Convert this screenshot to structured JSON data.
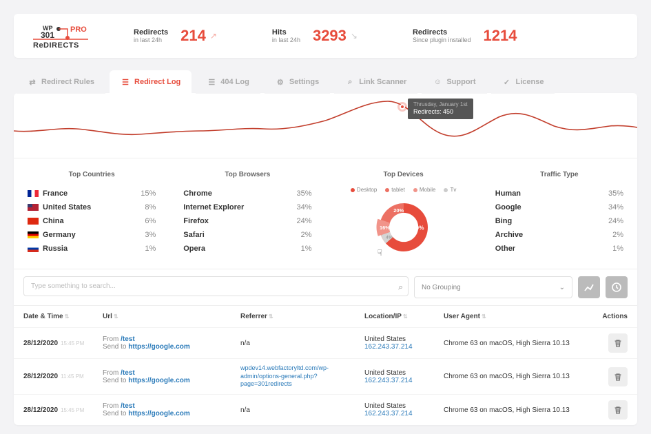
{
  "header": {
    "logo": {
      "wp": "WP",
      "num": "301",
      "pro": "PRO",
      "red": "ReDIRECTS"
    },
    "stats": [
      {
        "label": "Redirects",
        "sub": "in last 24h",
        "value": "214",
        "trend": "up"
      },
      {
        "label": "Hits",
        "sub": "in last 24h",
        "value": "3293",
        "trend": "down"
      },
      {
        "label": "Redirects",
        "sub": "Since plugin installed",
        "value": "1214",
        "trend": ""
      }
    ]
  },
  "tabs": [
    {
      "id": "rules",
      "label": "Redirect Rules"
    },
    {
      "id": "log",
      "label": "Redirect Log"
    },
    {
      "id": "404",
      "label": "404 Log"
    },
    {
      "id": "settings",
      "label": "Settings"
    },
    {
      "id": "scanner",
      "label": "Link Scanner"
    },
    {
      "id": "support",
      "label": "Support"
    },
    {
      "id": "license",
      "label": "License"
    }
  ],
  "active_tab": "log",
  "chart_tooltip": {
    "date": "Thrusday, January 1st",
    "text": "Redirects: 450"
  },
  "panels": {
    "countries": {
      "title": "Top Countries",
      "rows": [
        {
          "flag": "fr",
          "name": "France",
          "pct": "15%"
        },
        {
          "flag": "us",
          "name": "United States",
          "pct": "8%"
        },
        {
          "flag": "cn",
          "name": "China",
          "pct": "6%"
        },
        {
          "flag": "de",
          "name": "Germany",
          "pct": "3%"
        },
        {
          "flag": "ru",
          "name": "Russia",
          "pct": "1%"
        }
      ]
    },
    "browsers": {
      "title": "Top Browsers",
      "rows": [
        {
          "name": "Chrome",
          "pct": "35%"
        },
        {
          "name": "Internet Explorer",
          "pct": "34%"
        },
        {
          "name": "Firefox",
          "pct": "24%"
        },
        {
          "name": "Safari",
          "pct": "2%"
        },
        {
          "name": "Opera",
          "pct": "1%"
        }
      ]
    },
    "devices": {
      "title": "Top Devices",
      "legend": [
        "Desktop",
        "tablet",
        "Mobile",
        "Tv"
      ],
      "donut": [
        {
          "label": "60%",
          "value": 60
        },
        {
          "label": "20%",
          "value": 20
        },
        {
          "label": "16%",
          "value": 16
        },
        {
          "label": "4%",
          "value": 4
        }
      ]
    },
    "traffic": {
      "title": "Traffic Type",
      "rows": [
        {
          "name": "Human",
          "pct": "35%"
        },
        {
          "name": "Google",
          "pct": "34%"
        },
        {
          "name": "Bing",
          "pct": "24%"
        },
        {
          "name": "Archive",
          "pct": "2%"
        },
        {
          "name": "Other",
          "pct": "1%"
        }
      ]
    }
  },
  "search_placeholder": "Type something to search...",
  "grouping_label": "No Grouping",
  "table": {
    "columns": {
      "dt": "Date & Time",
      "url": "Url",
      "ref": "Referrer",
      "loc": "Location/IP",
      "ua": "User Agent",
      "act": "Actions"
    },
    "from_label": "From",
    "to_label": "Send to",
    "rows": [
      {
        "date": "28/12/2020",
        "time": "15:45 PM",
        "from": "/test",
        "to": "https://google.com",
        "ref": "n/a",
        "country": "United States",
        "ip": "162.243.37.214",
        "ua": "Chrome 63 on macOS, High Sierra 10.13"
      },
      {
        "date": "28/12/2020",
        "time": "11:45 PM",
        "from": "/test",
        "to": "https://google.com",
        "ref": "wpdev14.webfactoryltd.com/wp-admin/options-general.php?page=301redirects",
        "country": "United States",
        "ip": "162.243.37.214",
        "ua": "Chrome 63 on macOS, High Sierra 10.13"
      },
      {
        "date": "28/12/2020",
        "time": "15:45 PM",
        "from": "/test",
        "to": "https://google.com",
        "ref": "n/a",
        "country": "United States",
        "ip": "162.243.37.214",
        "ua": "Chrome 63 on macOS, High Sierra 10.13"
      }
    ]
  },
  "chart_data": {
    "type": "line",
    "title": "",
    "series": [
      {
        "name": "Redirects",
        "values": [
          180,
          170,
          210,
          190,
          170,
          150,
          160,
          190,
          180,
          200,
          260,
          450,
          380,
          260,
          160,
          170,
          280,
          320,
          260,
          200,
          200,
          230,
          250,
          230
        ]
      }
    ],
    "ylim": [
      0,
      500
    ],
    "highlight": {
      "x_index": 11,
      "value": 450,
      "label": "Thrusday, January 1st"
    }
  }
}
